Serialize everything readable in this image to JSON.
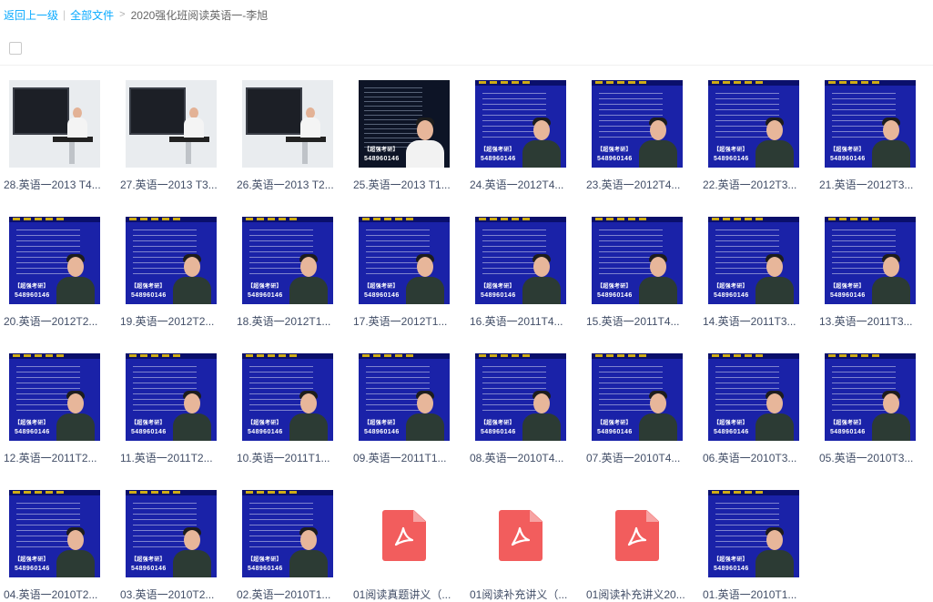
{
  "breadcrumb": {
    "back_label": "返回上一级",
    "all_files_label": "全部文件",
    "separator": ">",
    "current_folder": "2020强化班阅读英语一-李旭"
  },
  "thumbnail_overlay": {
    "tag": "【超强考研】",
    "number": "548960146"
  },
  "colors": {
    "link": "#09aaff",
    "video_bg": "#1a22a8",
    "pdf_red": "#f25d5d"
  },
  "files": [
    {
      "name": "28.英语一2013 T4...",
      "type": "video",
      "style": "studio"
    },
    {
      "name": "27.英语一2013 T3...",
      "type": "video",
      "style": "studio"
    },
    {
      "name": "26.英语一2013 T2...",
      "type": "video",
      "style": "studio"
    },
    {
      "name": "25.英语一2013 T1...",
      "type": "video",
      "style": "dark"
    },
    {
      "name": "24.英语一2012T4...",
      "type": "video",
      "style": "blue"
    },
    {
      "name": "23.英语一2012T4...",
      "type": "video",
      "style": "blue"
    },
    {
      "name": "22.英语一2012T3...",
      "type": "video",
      "style": "blue"
    },
    {
      "name": "21.英语一2012T3...",
      "type": "video",
      "style": "blue"
    },
    {
      "name": "20.英语一2012T2...",
      "type": "video",
      "style": "blue"
    },
    {
      "name": "19.英语一2012T2...",
      "type": "video",
      "style": "blue"
    },
    {
      "name": "18.英语一2012T1...",
      "type": "video",
      "style": "blue"
    },
    {
      "name": "17.英语一2012T1...",
      "type": "video",
      "style": "blue"
    },
    {
      "name": "16.英语一2011T4...",
      "type": "video",
      "style": "blue"
    },
    {
      "name": "15.英语一2011T4...",
      "type": "video",
      "style": "blue"
    },
    {
      "name": "14.英语一2011T3...",
      "type": "video",
      "style": "blue"
    },
    {
      "name": "13.英语一2011T3...",
      "type": "video",
      "style": "blue"
    },
    {
      "name": "12.英语一2011T2...",
      "type": "video",
      "style": "blue"
    },
    {
      "name": "11.英语一2011T2...",
      "type": "video",
      "style": "blue"
    },
    {
      "name": "10.英语一2011T1...",
      "type": "video",
      "style": "blue"
    },
    {
      "name": "09.英语一2011T1...",
      "type": "video",
      "style": "blue"
    },
    {
      "name": "08.英语一2010T4...",
      "type": "video",
      "style": "blue"
    },
    {
      "name": "07.英语一2010T4...",
      "type": "video",
      "style": "blue"
    },
    {
      "name": "06.英语一2010T3...",
      "type": "video",
      "style": "blue"
    },
    {
      "name": "05.英语一2010T3...",
      "type": "video",
      "style": "blue"
    },
    {
      "name": "04.英语一2010T2...",
      "type": "video",
      "style": "blue"
    },
    {
      "name": "03.英语一2010T2...",
      "type": "video",
      "style": "blue"
    },
    {
      "name": "02.英语一2010T1...",
      "type": "video",
      "style": "blue"
    },
    {
      "name": "01阅读真题讲义（...",
      "type": "pdf",
      "icon": "pdf-icon"
    },
    {
      "name": "01阅读补充讲义（...",
      "type": "pdf",
      "icon": "pdf-icon"
    },
    {
      "name": "01阅读补充讲义20...",
      "type": "pdf",
      "icon": "pdf-icon"
    },
    {
      "name": "01.英语一2010T1...",
      "type": "video",
      "style": "blue"
    }
  ]
}
